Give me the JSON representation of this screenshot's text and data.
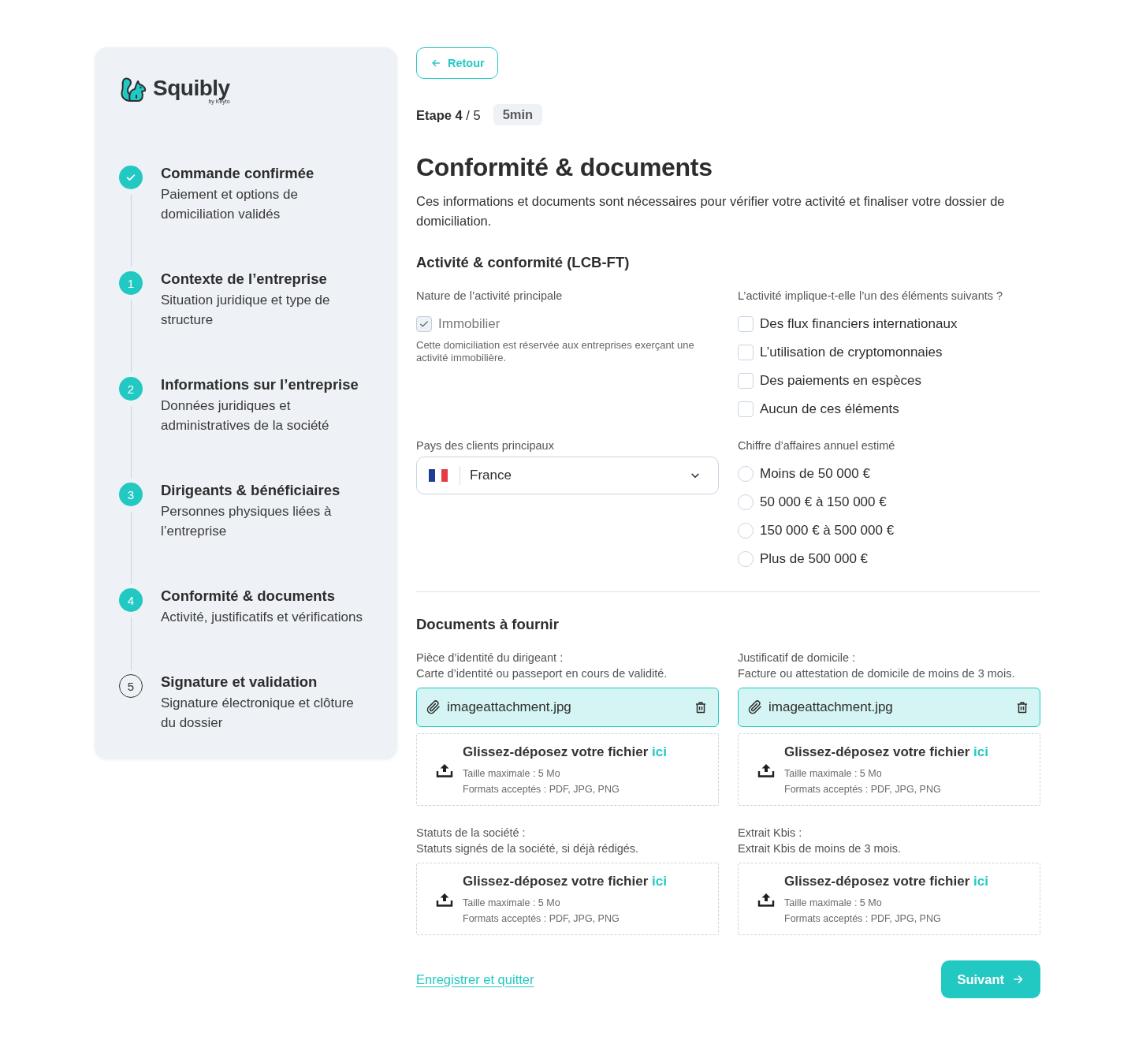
{
  "sidebar": {
    "logo": {
      "name": "Squibly",
      "tagline": "by Keyto"
    },
    "steps": [
      {
        "kind": "check",
        "filled": true,
        "title": "Commande confirmée",
        "subtitle": "Paiement et options de domiciliation validés"
      },
      {
        "kind": "number",
        "number": "1",
        "filled": true,
        "title": "Contexte de l’entreprise",
        "subtitle": "Situation juridique et type de structure"
      },
      {
        "kind": "number",
        "number": "2",
        "filled": true,
        "title": "Informations sur l’entreprise",
        "subtitle": "Données juridiques et administratives de la société"
      },
      {
        "kind": "number",
        "number": "3",
        "filled": true,
        "title": "Dirigeants & bénéficiaires",
        "subtitle": "Personnes physiques liées à l’entreprise"
      },
      {
        "kind": "number",
        "number": "4",
        "filled": true,
        "title": "Conformité & documents",
        "subtitle": "Activité, justificatifs et vérifications"
      },
      {
        "kind": "number",
        "number": "5",
        "filled": false,
        "title": "Signature et validation",
        "subtitle": "Signature électronique et clôture du dossier"
      }
    ]
  },
  "header": {
    "back_button": "Retour",
    "step_counter": "**Etape 4** / 5",
    "duration": "5min"
  },
  "title": "Conformité & documents",
  "description": "Ces informations et documents sont nécessaires pour vérifier votre activité et finaliser votre dossier de domiciliation.",
  "compliance": {
    "title": "Activité & conformité (LCB-FT)",
    "activity": {
      "label": "Nature de l’activité principale",
      "options": [
        {
          "label": "Immobilier",
          "checked": true,
          "disabled": true
        }
      ],
      "help": "Cette domiciliation est réservée aux entreprises exerçant une activité immobilière."
    },
    "risks": {
      "label": "L’activité implique-t-elle l’un des éléments suivants ?",
      "options": [
        {
          "label": "Des flux financiers internationaux",
          "checked": false,
          "disabled": false
        },
        {
          "label": "L’utilisation de cryptomonnaies",
          "checked": false,
          "disabled": false
        },
        {
          "label": "Des paiements en espèces",
          "checked": false,
          "disabled": false
        },
        {
          "label": "Aucun de ces éléments",
          "checked": false,
          "disabled": false
        }
      ]
    },
    "country": {
      "label": "Pays des clients principaux",
      "value": "France"
    },
    "revenue": {
      "label": "Chiffre d’affaires annuel estimé",
      "options": [
        {
          "label": "Moins de 50 000 €",
          "selected": false
        },
        {
          "label": "50 000 € à 150 000 €",
          "selected": false
        },
        {
          "label": "150 000 € à 500 000 €",
          "selected": false
        },
        {
          "label": "Plus de 500 000 €",
          "selected": false
        }
      ]
    }
  },
  "documents": {
    "title": "Documents à fournir",
    "items": [
      {
        "label": "Pièce d’identité du dirigeant :",
        "hint": "Carte d’identité ou passeport en cours de validité.",
        "file": "imageattachment.jpg",
        "dropzone": {
          "title": "Glissez-déposez votre fichier",
          "link": "ici",
          "max_size": "Taille maximale : 5 Mo",
          "formats": "Formats acceptés : PDF, JPG, PNG"
        }
      },
      {
        "label": "Justificatif de domicile :",
        "hint": "Facture ou attestation de domicile de moins de 3 mois.",
        "file": "imageattachment.jpg",
        "dropzone": {
          "title": "Glissez-déposez votre fichier",
          "link": "ici",
          "max_size": "Taille maximale : 5 Mo",
          "formats": "Formats acceptés : PDF, JPG, PNG"
        }
      },
      {
        "label": "Statuts de la société :",
        "hint": "Statuts signés de la société, si déjà rédigés.",
        "dropzone": {
          "title": "Glissez-déposez votre fichier",
          "link": "ici",
          "max_size": "Taille maximale : 5 Mo",
          "formats": "Formats acceptés : PDF, JPG, PNG"
        }
      },
      {
        "label": "Extrait Kbis :",
        "hint": "Extrait Kbis de moins de 3 mois.",
        "dropzone": {
          "title": "Glissez-déposez votre fichier",
          "link": "ici",
          "max_size": "Taille maximale : 5 Mo",
          "formats": "Formats acceptés : PDF, JPG, PNG"
        }
      }
    ]
  },
  "footer": {
    "save_link": "Enregistrer et quitter",
    "next_button": "Suivant"
  }
}
